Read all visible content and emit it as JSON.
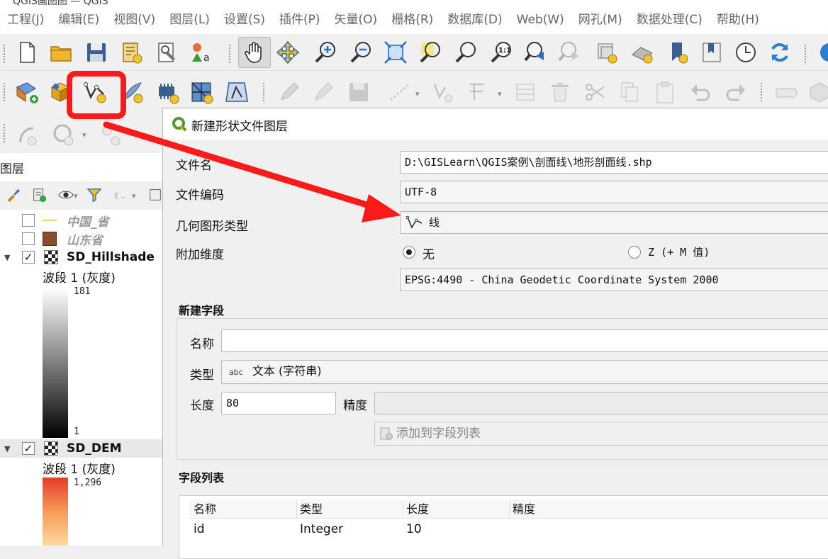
{
  "window": {
    "title": "QGIS画图图 — QGIS"
  },
  "menubar": [
    "工程(J)",
    "编辑(E)",
    "视图(V)",
    "图层(L)",
    "设置(S)",
    "插件(P)",
    "矢量(O)",
    "栅格(R)",
    "数据库(D)",
    "Web(W)",
    "网孔(M)",
    "数据处理(C)",
    "帮助(H)"
  ],
  "toolbar": {
    "row1": [
      "new-project-icon",
      "open-project-icon",
      "save-project-icon",
      "new-print-layout-icon",
      "layout-manager-icon",
      "style-manager-icon",
      "pan-icon",
      "pan-to-selection-icon",
      "zoom-in-icon",
      "zoom-out-icon",
      "zoom-full-icon",
      "zoom-to-selection-icon",
      "zoom-to-layer-icon",
      "zoom-native-icon",
      "zoom-last-icon",
      "zoom-next-icon",
      "new-map-view-icon",
      "new-3d-map-view-icon",
      "new-bookmark-icon",
      "show-bookmarks-icon",
      "temporal-controller-icon",
      "refresh-icon",
      "help-icon"
    ],
    "row2": [
      "data-source-manager-icon",
      "new-geopackage-layer-icon",
      "new-shapefile-layer-icon",
      "new-spatialite-layer-icon",
      "new-virtual-layer-icon",
      "new-mesh-layer-icon",
      "new-gps-layer-icon",
      "current-edits-icon",
      "toggle-editing-icon",
      "save-edits-icon",
      "digitize-line-icon",
      "vertex-tool-icon",
      "modify-attributes-icon",
      "delete-selected-icon",
      "cut-features-icon",
      "copy-features-icon",
      "paste-features-icon",
      "undo-icon",
      "redo-icon",
      "label-toolbar-icon",
      "3d-icon"
    ],
    "row3": [
      "georeferencer-icon",
      "select-features-icon",
      "snapping-icon"
    ]
  },
  "layers_panel": {
    "title": "图层",
    "layers": [
      {
        "name": "中国_省",
        "checked": false,
        "visible_style": "line",
        "color": "#f0d060"
      },
      {
        "name": "山东省",
        "checked": false,
        "visible_style": "fill",
        "color": "#8b4d2d"
      },
      {
        "name": "SD_Hillshade",
        "checked": true,
        "band": "波段 1 (灰度)",
        "max": "181",
        "min": "1"
      },
      {
        "name": "SD_DEM",
        "checked": true,
        "band": "波段 1 (灰度)",
        "max": "1,296"
      }
    ]
  },
  "dialog": {
    "title": "新建形状文件图层",
    "filename_label": "文件名",
    "filename_value": "D:\\GISLearn\\QGIS案例\\剖面线\\地形剖面线.shp",
    "encoding_label": "文件编码",
    "encoding_value": "UTF-8",
    "geometry_label": "几何图形类型",
    "geometry_value": "线",
    "dimension_label": "附加维度",
    "dim_none": "无",
    "dim_zm": "Z (+ M 值)",
    "crs_value": "EPSG:4490 - China Geodetic Coordinate System 2000",
    "new_field_section": "新建字段",
    "name_label": "名称",
    "name_value": "",
    "type_label": "类型",
    "type_icon_text": "abc",
    "type_value": "文本 (字符串)",
    "length_label": "长度",
    "length_value": "80",
    "precision_label": "精度",
    "precision_value": "",
    "add_field_button": "添加到字段列表",
    "field_list_section": "字段列表",
    "table": {
      "headers": [
        "名称",
        "类型",
        "长度",
        "精度"
      ],
      "rows": [
        [
          "id",
          "Integer",
          "10",
          ""
        ]
      ]
    }
  },
  "colors": {
    "highlight": "#ff1a1a",
    "qgis_green": "#589632",
    "dem_top": "#e53b2c"
  }
}
